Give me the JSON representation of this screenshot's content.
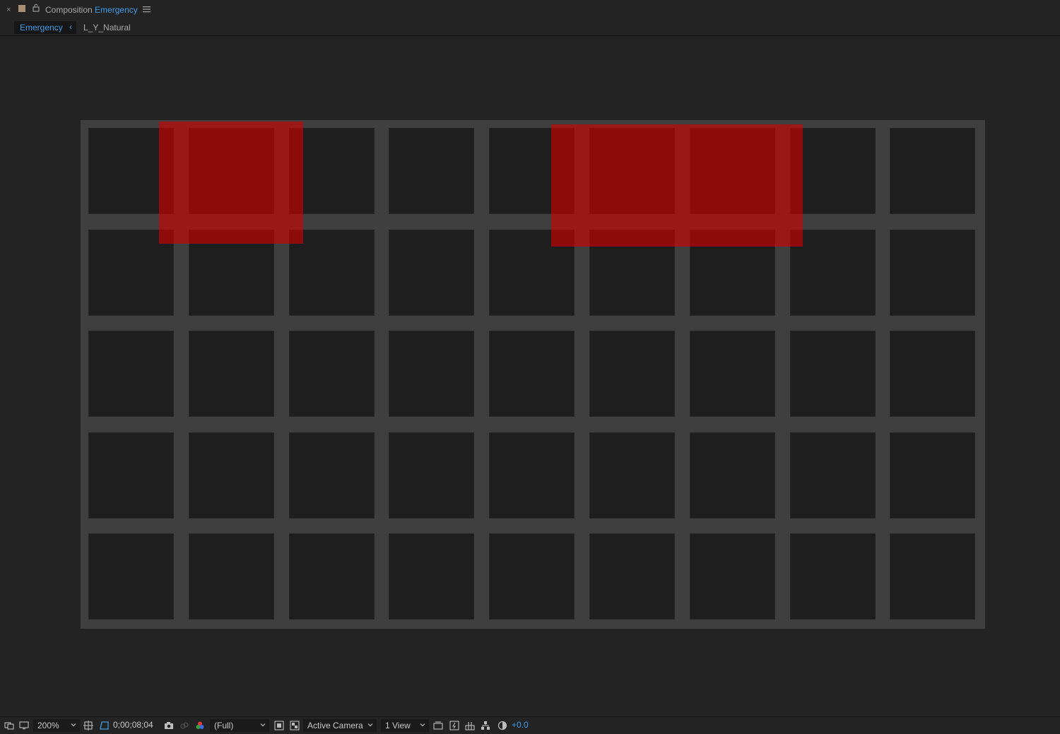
{
  "panel": {
    "title_prefix": "Composition",
    "comp_name": "Emergency",
    "close_glyph": "×"
  },
  "breadcrumbs": {
    "active": "Emergency",
    "active_chevron": "‹",
    "next": "L_Y_Natural"
  },
  "footer": {
    "magnification": "200%",
    "timecode": "0;00;08;04",
    "resolution": "(Full)",
    "camera": "Active Camera",
    "views": "1 View",
    "exposure": "+0.0"
  },
  "colors": {
    "accent": "#3c9be8",
    "label_swatch": "#a88e73",
    "highlight_red": "#d20000"
  }
}
